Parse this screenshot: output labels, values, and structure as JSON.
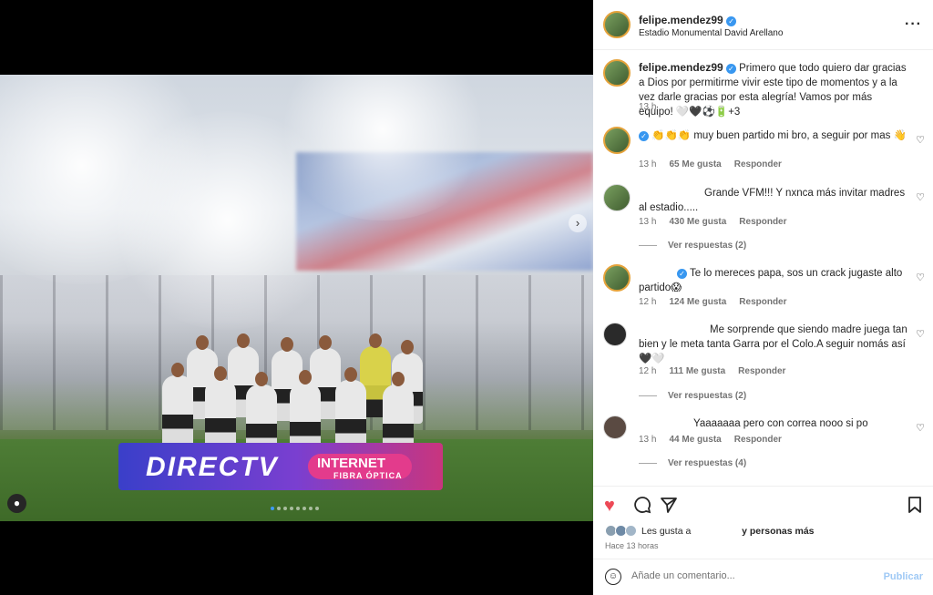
{
  "post": {
    "username": "felipe.mendez99",
    "location": "Estadio Monumental David Arellano",
    "caption": "Primero que todo quiero dar gracias a Dios por permitirme vivir este tipo de momentos y a la vez darle gracias por esta alegría! Vamos por más equipo! 🤍🖤⚽🔋+3",
    "caption_time": "13 h",
    "more_icon": "more-horizontal-icon"
  },
  "media": {
    "adboard_brand": "DIRECTV",
    "adboard_line1": "INTERNET",
    "adboard_line2": "FIBRA ÓPTICA",
    "next_arrow": "›",
    "carousel_count": 8,
    "carousel_active": 0
  },
  "comments": [
    {
      "text": "👏👏👏 muy buen partido mi bro, a seguir por mas 👋",
      "time": "13 h",
      "likes": "65 Me gusta",
      "reply": "Responder",
      "verified": true
    },
    {
      "text": "Grande VFM!!! Y nxnca más invitar madres al estadio.....",
      "time": "13 h",
      "likes": "430 Me gusta",
      "reply": "Responder",
      "replies": "Ver respuestas (2)"
    },
    {
      "text": "Te lo mereces papa, sos un crack jugaste alto partido😱",
      "time": "12 h",
      "likes": "124 Me gusta",
      "reply": "Responder",
      "verified": true
    },
    {
      "text": "Me sorprende que siendo madre juega tan bien y le meta tanta Garra por el Colo.A seguir nomás así 🖤🤍",
      "time": "12 h",
      "likes": "111 Me gusta",
      "reply": "Responder",
      "replies": "Ver respuestas (2)"
    },
    {
      "text": "Yaaaaaaa pero con correa nooo si po",
      "time": "13 h",
      "likes": "44 Me gusta",
      "reply": "Responder",
      "replies": "Ver respuestas (4)"
    }
  ],
  "actions": {
    "likes_prefix": "Les gusta a",
    "likes_suffix": "y personas más",
    "time": "Hace 13 horas"
  },
  "composer": {
    "placeholder": "Añade un comentario...",
    "publish": "Publicar"
  },
  "colors": {
    "like_red": "#ed4956",
    "link_blue": "#3897f0",
    "muted": "#737373"
  }
}
